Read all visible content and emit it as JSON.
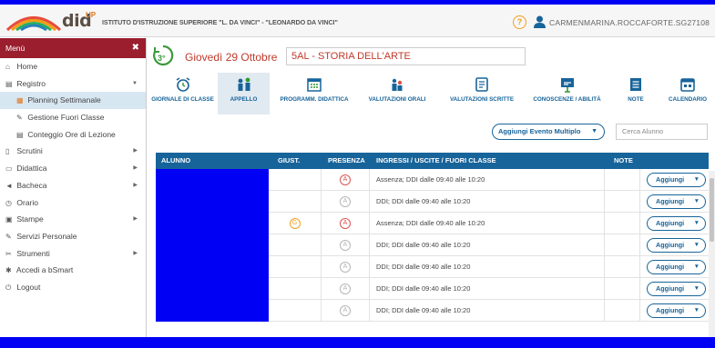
{
  "header": {
    "logo_text": "did",
    "logo_sup": "UP",
    "school": "ISTITUTO D'ISTRUZIONE SUPERIORE \"L. DA VINCI\" - \"LEONARDO DA VINCI\"",
    "help": "?",
    "user": "CARMENMARINA.ROCCAFORTE.SG27108"
  },
  "sidebar": {
    "title": "Menù",
    "close": "✖",
    "items": [
      {
        "label": "Home",
        "icon": "home-icon",
        "glyph": "⌂"
      },
      {
        "label": "Registro",
        "icon": "calendar-icon",
        "glyph": "▤"
      },
      {
        "label": "Planning Settimanale",
        "icon": "calendar-icon",
        "glyph": "▦"
      },
      {
        "label": "Gestione Fuori Classe",
        "icon": "edit-icon",
        "glyph": "✎"
      },
      {
        "label": "Conteggio Ore di Lezione",
        "icon": "list-icon",
        "glyph": "▤"
      },
      {
        "label": "Scrutini",
        "icon": "document-icon",
        "glyph": "▯"
      },
      {
        "label": "Didattica",
        "icon": "book-icon",
        "glyph": "▭"
      },
      {
        "label": "Bacheca",
        "icon": "megaphone-icon",
        "glyph": "◄"
      },
      {
        "label": "Orario",
        "icon": "clock-icon",
        "glyph": "◷"
      },
      {
        "label": "Stampe",
        "icon": "printer-icon",
        "glyph": "▣"
      },
      {
        "label": "Servizi Personale",
        "icon": "edit-icon",
        "glyph": "✎"
      },
      {
        "label": "Strumenti",
        "icon": "tools-icon",
        "glyph": "✂"
      },
      {
        "label": "Accedi a bSmart",
        "icon": "star-icon",
        "glyph": "✱"
      },
      {
        "label": "Logout",
        "icon": "power-icon",
        "glyph": "⏻"
      }
    ]
  },
  "date_bar": {
    "day_badge": "3°",
    "date": "Giovedì 29 Ottobre",
    "class_name": "5AL - STORIA DELL'ARTE"
  },
  "toolbar": [
    {
      "label": "GIORNALE DI CLASSE",
      "icon": "alarm-clock-icon"
    },
    {
      "label": "APPELLO",
      "icon": "people-icon"
    },
    {
      "label": "PROGRAMM. DIDATTICA",
      "icon": "calendar-grid-icon"
    },
    {
      "label": "VALUTAZIONI ORALI",
      "icon": "people-voice-icon"
    },
    {
      "label": "VALUTAZIONI SCRITTE",
      "icon": "document-icon"
    },
    {
      "label": "CONOSCENZE / ABILITÀ",
      "icon": "presentation-icon"
    },
    {
      "label": "NOTE",
      "icon": "notepad-icon"
    },
    {
      "label": "CALENDARIO",
      "icon": "calendar-icon"
    }
  ],
  "actions": {
    "multi_event": "Aggiungi Evento Multiplo",
    "search_placeholder": "Cerca Alunno"
  },
  "table": {
    "headers": {
      "alunno": "ALUNNO",
      "giust": "GIUST.",
      "presenza": "PRESENZA",
      "ingressi": "INGRESSI / USCITE / FUORI CLASSE",
      "note": "NOTE"
    },
    "add_label": "Aggiungi",
    "rows": [
      {
        "giust": "",
        "presenza": "A",
        "presenza_color": "red",
        "ingressi": "Assenza; DDI dalle 09:40 alle 10:20"
      },
      {
        "giust": "",
        "presenza": "A",
        "presenza_color": "grey",
        "ingressi": "DDI; DDI dalle 09:40 alle 10:20"
      },
      {
        "giust": "G",
        "presenza": "A",
        "presenza_color": "red",
        "ingressi": "Assenza; DDI dalle 09:40 alle 10:20"
      },
      {
        "giust": "",
        "presenza": "A",
        "presenza_color": "grey",
        "ingressi": "DDI; DDI dalle 09:40 alle 10:20"
      },
      {
        "giust": "",
        "presenza": "A",
        "presenza_color": "grey",
        "ingressi": "DDI; DDI dalle 09:40 alle 10:20"
      },
      {
        "giust": "",
        "presenza": "A",
        "presenza_color": "grey",
        "ingressi": "DDI; DDI dalle 09:40 alle 10:20"
      },
      {
        "giust": "",
        "presenza": "A",
        "presenza_color": "grey",
        "ingressi": "DDI; DDI dalle 09:40 alle 10:20"
      }
    ]
  }
}
